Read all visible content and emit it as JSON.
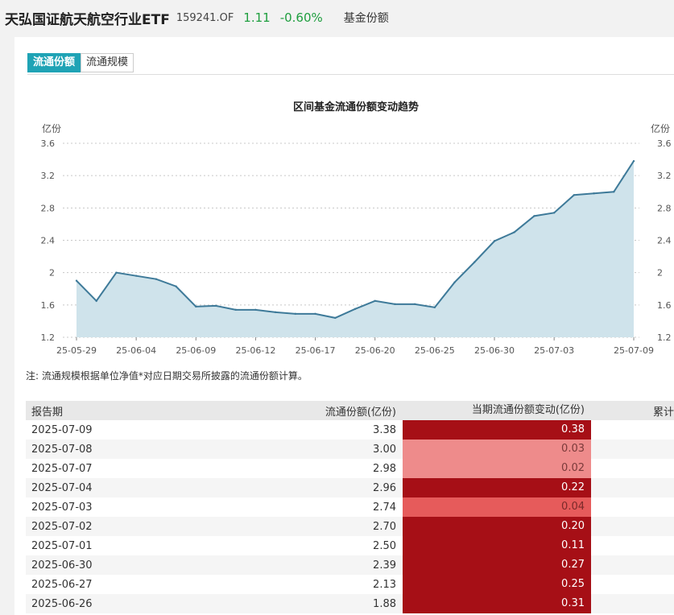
{
  "header": {
    "fund_name": "天弘国证航天航空行业ETF",
    "fund_code": "159241.OF",
    "price": "1.11",
    "change": "-0.60%",
    "section": "基金份额"
  },
  "tabs": [
    {
      "label": "流通份额",
      "active": true
    },
    {
      "label": "流通规模",
      "active": false
    }
  ],
  "chart_data": {
    "type": "area",
    "title": "区间基金流通份额变动趋势",
    "ylabel": "亿份",
    "y2label": "亿份",
    "ylim": [
      1.2,
      3.6
    ],
    "yticks": [
      "1.2",
      "1.6",
      "2",
      "2.4",
      "2.8",
      "3.2",
      "3.6"
    ],
    "xtick_labels": [
      "25-05-29",
      "25-06-04",
      "25-06-09",
      "25-06-12",
      "25-06-17",
      "25-06-20",
      "25-06-25",
      "25-06-30",
      "25-07-03",
      "25-07-09"
    ],
    "grid": true,
    "colors": {
      "line": "#3e7a99",
      "fill": "#cfe3eb",
      "grid": "#c8c8c8"
    },
    "x": [
      "2025-05-29",
      "2025-05-30",
      "2025-06-03",
      "2025-06-04",
      "2025-06-05",
      "2025-06-06",
      "2025-06-09",
      "2025-06-10",
      "2025-06-11",
      "2025-06-12",
      "2025-06-13",
      "2025-06-16",
      "2025-06-17",
      "2025-06-18",
      "2025-06-19",
      "2025-06-20",
      "2025-06-23",
      "2025-06-24",
      "2025-06-25",
      "2025-06-26",
      "2025-06-27",
      "2025-06-30",
      "2025-07-01",
      "2025-07-02",
      "2025-07-03",
      "2025-07-04",
      "2025-07-07",
      "2025-07-08",
      "2025-07-09"
    ],
    "series": [
      {
        "values": [
          1.9,
          1.65,
          2.0,
          1.96,
          1.92,
          1.83,
          1.58,
          1.59,
          1.54,
          1.54,
          1.51,
          1.49,
          1.49,
          1.44,
          1.55,
          1.65,
          1.61,
          1.61,
          1.57,
          1.88,
          2.13,
          2.39,
          2.5,
          2.7,
          2.74,
          2.96,
          2.98,
          3.0,
          3.38
        ]
      }
    ]
  },
  "note": "注:   流通规模根据单位净值*对应日期交易所披露的流通份额计算。",
  "table": {
    "headers": {
      "date": "报告期",
      "share": "流通份额(亿份)",
      "change": "当期流通份额变动(亿份)",
      "cumulative": "累计"
    },
    "rows": [
      {
        "date": "2025-07-09",
        "share": "3.38",
        "change": "0.38",
        "color": "#a60f16",
        "text_color": "#ffffff"
      },
      {
        "date": "2025-07-08",
        "share": "3.00",
        "change": "0.03",
        "color": "#ee8b8b",
        "text_color": "#7a3a3a"
      },
      {
        "date": "2025-07-07",
        "share": "2.98",
        "change": "0.02",
        "color": "#ee8b8b",
        "text_color": "#7a3a3a"
      },
      {
        "date": "2025-07-04",
        "share": "2.96",
        "change": "0.22",
        "color": "#a60f16",
        "text_color": "#ffffff"
      },
      {
        "date": "2025-07-03",
        "share": "2.74",
        "change": "0.04",
        "color": "#e65b5b",
        "text_color": "#7a2a2a"
      },
      {
        "date": "2025-07-02",
        "share": "2.70",
        "change": "0.20",
        "color": "#a60f16",
        "text_color": "#ffffff"
      },
      {
        "date": "2025-07-01",
        "share": "2.50",
        "change": "0.11",
        "color": "#a60f16",
        "text_color": "#ffffff"
      },
      {
        "date": "2025-06-30",
        "share": "2.39",
        "change": "0.27",
        "color": "#a60f16",
        "text_color": "#ffffff"
      },
      {
        "date": "2025-06-27",
        "share": "2.13",
        "change": "0.25",
        "color": "#a60f16",
        "text_color": "#ffffff"
      },
      {
        "date": "2025-06-26",
        "share": "1.88",
        "change": "0.31",
        "color": "#a60f16",
        "text_color": "#ffffff"
      }
    ]
  }
}
